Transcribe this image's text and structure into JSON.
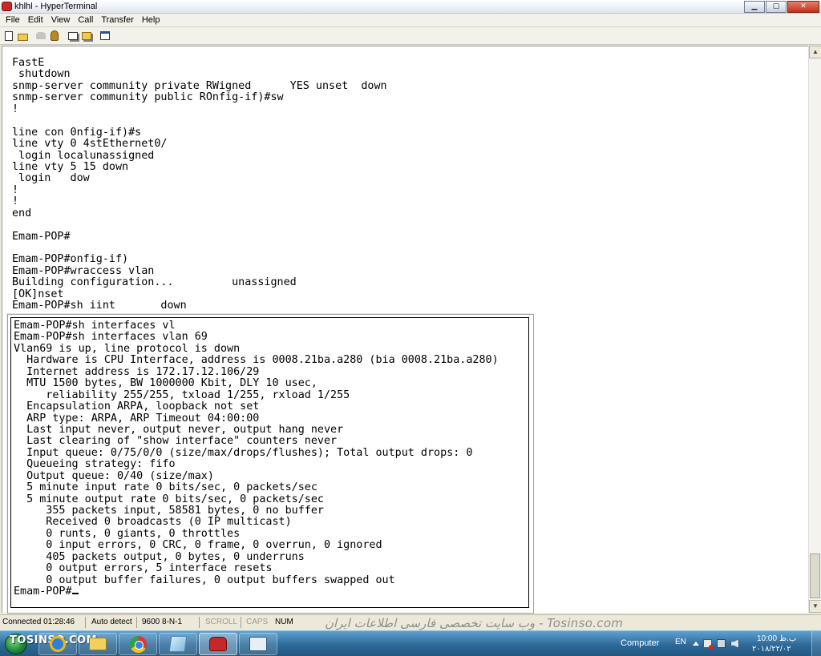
{
  "window": {
    "title": "khlhl - HyperTerminal"
  },
  "title_buttons": {
    "minimize": "▁",
    "maximize": "▢",
    "close": "✕"
  },
  "menu": [
    "File",
    "Edit",
    "View",
    "Call",
    "Transfer",
    "Help"
  ],
  "toolbar_icons": [
    "new-connection-icon",
    "open-icon",
    "connect-icon",
    "disconnect-icon",
    "send-icon",
    "receive-icon",
    "properties-icon"
  ],
  "terminal": {
    "background_lines": [
      "FastE",
      " shutdown",
      "snmp-server community private RWigned      YES unset  down",
      "snmp-server community public ROnfig-if)#sw",
      "!",
      "",
      "line con 0nfig-if)#s",
      "line vty 0 4stEthernet0/",
      " login localunassigned",
      "line vty 5 15 down",
      " login   dow",
      "!",
      "!",
      "end",
      "",
      "Emam-POP#",
      "",
      "Emam-POP#onfig-if)",
      "Emam-POP#wraccess vlan",
      "Building configuration...         unassigned",
      "[OK]nset",
      "Emam-POP#sh iint       down"
    ],
    "popup_lines": [
      "Emam-POP#sh interfaces vl",
      "Emam-POP#sh interfaces vlan 69",
      "Vlan69 is up, line protocol is down",
      "  Hardware is CPU Interface, address is 0008.21ba.a280 (bia 0008.21ba.a280)",
      "  Internet address is 172.17.12.106/29",
      "  MTU 1500 bytes, BW 1000000 Kbit, DLY 10 usec,",
      "     reliability 255/255, txload 1/255, rxload 1/255",
      "  Encapsulation ARPA, loopback not set",
      "  ARP type: ARPA, ARP Timeout 04:00:00",
      "  Last input never, output never, output hang never",
      "  Last clearing of \"show interface\" counters never",
      "  Input queue: 0/75/0/0 (size/max/drops/flushes); Total output drops: 0",
      "  Queueing strategy: fifo",
      "  Output queue: 0/40 (size/max)",
      "  5 minute input rate 0 bits/sec, 0 packets/sec",
      "  5 minute output rate 0 bits/sec, 0 packets/sec",
      "     355 packets input, 58581 bytes, 0 no buffer",
      "     Received 0 broadcasts (0 IP multicast)",
      "     0 runts, 0 giants, 0 throttles",
      "     0 input errors, 0 CRC, 0 frame, 0 overrun, 0 ignored",
      "     405 packets output, 0 bytes, 0 underruns",
      "     0 output errors, 5 interface resets",
      "     0 output buffer failures, 0 output buffers swapped out"
    ],
    "prompt": "Emam-POP#"
  },
  "statusbar": {
    "connected": "Connected 01:28:46",
    "detect": "Auto detect",
    "settings": "9600 8-N-1",
    "scroll": "SCROLL",
    "caps": "CAPS",
    "num": "NUM",
    "watermark": "وب سایت تخصصی فارسی اطلاعات ایران - Tosinso.com"
  },
  "taskbar": {
    "brand": "TOSINSO.COM",
    "apps": [
      "internet-explorer-icon",
      "file-explorer-icon",
      "chrome-icon",
      "media-icon",
      "hyperterminal-icon",
      "network-icon"
    ],
    "tray": {
      "computer": "Computer",
      "lang": "EN",
      "time": "10:00 ب.ظ",
      "date": "۲۰۱۸/۲۲/۰۲"
    }
  }
}
